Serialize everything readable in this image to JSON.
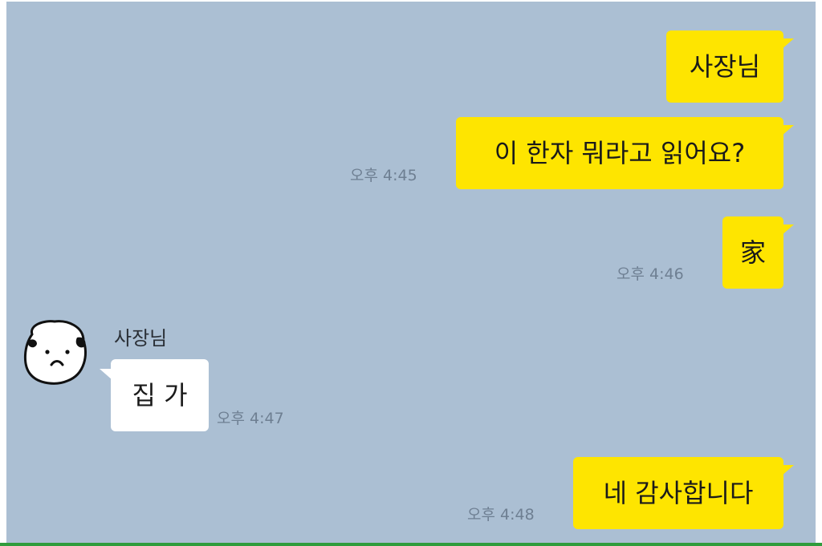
{
  "messages": [
    {
      "text": "사장님",
      "time": ""
    },
    {
      "text": "이 한자 뭐라고 읽어요?",
      "time": "오후 4:45"
    },
    {
      "text": "家",
      "time": "오후 4:46"
    },
    {
      "sender": "사장님",
      "text": "집 가",
      "time": "오후 4:47"
    },
    {
      "text": "네 감사합니다",
      "time": "오후 4:48"
    }
  ],
  "colors": {
    "background": "#abbfd3",
    "outgoing_bubble": "#fee500",
    "incoming_bubble": "#ffffff",
    "time": "#6e7f92"
  },
  "icons": {
    "avatar": "blob-face-avatar"
  }
}
